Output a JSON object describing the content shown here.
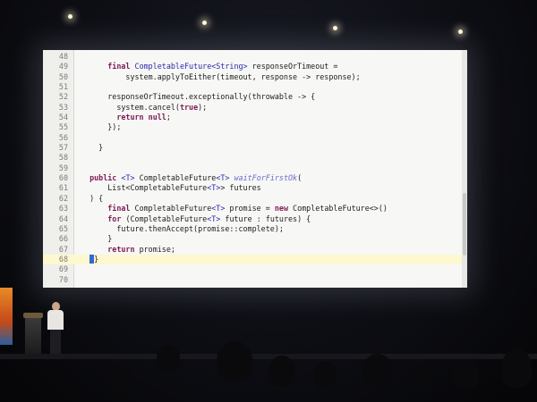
{
  "code_listing": {
    "lines": [
      {
        "n": "48",
        "segments": []
      },
      {
        "n": "49",
        "segments": [
          {
            "t": "      "
          },
          {
            "t": "final",
            "c": "kw"
          },
          {
            "t": " "
          },
          {
            "t": "CompletableFuture<String>",
            "c": "ty"
          },
          {
            "t": " responseOrTimeout ="
          }
        ]
      },
      {
        "n": "50",
        "segments": [
          {
            "t": "          system.applyToEither(timeout, response -> response);"
          }
        ]
      },
      {
        "n": "51",
        "segments": []
      },
      {
        "n": "52",
        "segments": [
          {
            "t": "      responseOrTimeout.exceptionally(throwable -> {"
          }
        ]
      },
      {
        "n": "53",
        "segments": [
          {
            "t": "        system.cancel("
          },
          {
            "t": "true",
            "c": "kw"
          },
          {
            "t": ");"
          }
        ]
      },
      {
        "n": "54",
        "segments": [
          {
            "t": "        "
          },
          {
            "t": "return",
            "c": "kw"
          },
          {
            "t": " "
          },
          {
            "t": "null",
            "c": "kw"
          },
          {
            "t": ";"
          }
        ]
      },
      {
        "n": "55",
        "segments": [
          {
            "t": "      });"
          }
        ]
      },
      {
        "n": "56",
        "segments": []
      },
      {
        "n": "57",
        "segments": [
          {
            "t": "    }"
          }
        ]
      },
      {
        "n": "58",
        "segments": []
      },
      {
        "n": "59",
        "segments": []
      },
      {
        "n": "60",
        "segments": [
          {
            "t": "  "
          },
          {
            "t": "public",
            "c": "kw"
          },
          {
            "t": " "
          },
          {
            "t": "<T>",
            "c": "ty"
          },
          {
            "t": " CompletableFuture"
          },
          {
            "t": "<T>",
            "c": "ty"
          },
          {
            "t": " "
          },
          {
            "t": "waitForFirstOk",
            "c": "mth"
          },
          {
            "t": "("
          }
        ]
      },
      {
        "n": "61",
        "segments": [
          {
            "t": "      List<CompletableFuture"
          },
          {
            "t": "<T>",
            "c": "ty"
          },
          {
            "t": "> futures"
          }
        ]
      },
      {
        "n": "62",
        "segments": [
          {
            "t": "  ) {"
          }
        ]
      },
      {
        "n": "63",
        "segments": [
          {
            "t": "      "
          },
          {
            "t": "final",
            "c": "kw"
          },
          {
            "t": " CompletableFuture"
          },
          {
            "t": "<T>",
            "c": "ty"
          },
          {
            "t": " promise = "
          },
          {
            "t": "new",
            "c": "kw"
          },
          {
            "t": " CompletableFuture<>()"
          }
        ]
      },
      {
        "n": "64",
        "segments": [
          {
            "t": "      "
          },
          {
            "t": "for",
            "c": "kw"
          },
          {
            "t": " (CompletableFuture"
          },
          {
            "t": "<T>",
            "c": "ty"
          },
          {
            "t": " future : futures) {"
          }
        ]
      },
      {
        "n": "65",
        "segments": [
          {
            "t": "        future.thenAccept(promise::complete);"
          }
        ]
      },
      {
        "n": "66",
        "segments": [
          {
            "t": "      }"
          }
        ]
      },
      {
        "n": "67",
        "segments": [
          {
            "t": "      "
          },
          {
            "t": "return",
            "c": "kw"
          },
          {
            "t": " promise;"
          }
        ]
      },
      {
        "n": "68",
        "segments": [
          {
            "t": "  "
          },
          {
            "t": "}",
            "cursor": true
          }
        ],
        "current": true
      },
      {
        "n": "69",
        "segments": []
      },
      {
        "n": "70",
        "segments": []
      }
    ]
  },
  "colors": {
    "keyword": "#7d1b55",
    "type_param": "#2a2ab0",
    "method_name": "#6a6ad0",
    "current_line": "#fdf8cf",
    "screen_bg": "#f7f7f5"
  },
  "scene_icons": [
    "ceiling-light",
    "speaker",
    "lectern",
    "banner",
    "audience-head"
  ]
}
